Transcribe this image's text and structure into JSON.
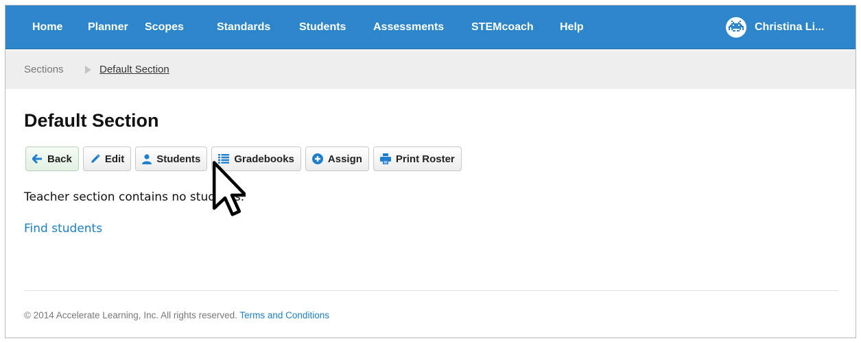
{
  "nav": {
    "items": [
      "Home",
      "Planner",
      "Scopes",
      "Standards",
      "Students",
      "Assessments",
      "STEMcoach",
      "Help"
    ],
    "user_name": "Christina Li..."
  },
  "breadcrumb": {
    "parent": "Sections",
    "current": "Default Section"
  },
  "page": {
    "title": "Default Section"
  },
  "toolbar": {
    "back": "Back",
    "edit": "Edit",
    "students": "Students",
    "gradebooks": "Gradebooks",
    "assign": "Assign",
    "print_roster": "Print Roster"
  },
  "content": {
    "message": "Teacher section contains no students.",
    "find_students": "Find students"
  },
  "footer": {
    "copyright": "© 2014 Accelerate Learning, Inc. All rights reserved.",
    "terms": "Terms and Conditions"
  },
  "colors": {
    "nav_bg": "#2d86c9",
    "link": "#1a7fc4",
    "breadcrumb_bg": "#eeeeee"
  }
}
